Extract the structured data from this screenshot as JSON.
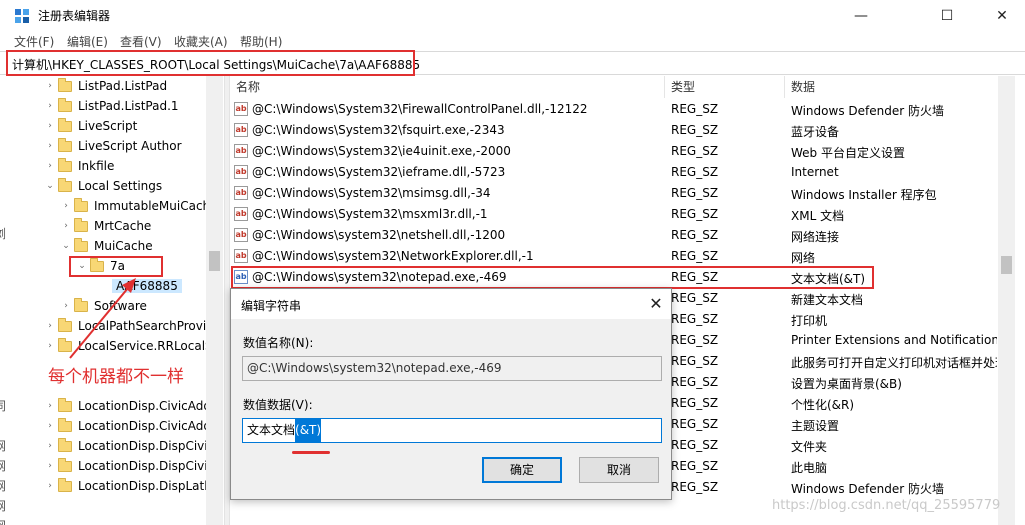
{
  "window": {
    "title": "注册表编辑器",
    "minimize_glyph": "—",
    "maximize_glyph": "☐",
    "close_glyph": "✕"
  },
  "menu": [
    "文件(F)",
    "编辑(E)",
    "查看(V)",
    "收藏夹(A)",
    "帮助(H)"
  ],
  "address": "计算机\\HKEY_CLASSES_ROOT\\Local Settings\\MuiCache\\7a\\AAF68885",
  "tree": [
    {
      "label": "ListPad.ListPad",
      "chevron": "›"
    },
    {
      "label": "ListPad.ListPad.1",
      "chevron": "›"
    },
    {
      "label": "LiveScript",
      "chevron": "›"
    },
    {
      "label": "LiveScript Author",
      "chevron": "›"
    },
    {
      "label": "Inkfile",
      "chevron": "›"
    },
    {
      "label": "Local Settings",
      "chevron": "⌄"
    },
    {
      "label": "ImmutableMuiCach",
      "chevron": "›"
    },
    {
      "label": "MrtCache",
      "chevron": "›"
    },
    {
      "label": "MuiCache",
      "chevron": "⌄"
    },
    {
      "label": "7a",
      "chevron": "⌄"
    },
    {
      "label": "AAF68885",
      "chevron": ""
    },
    {
      "label": "Software",
      "chevron": "›"
    },
    {
      "label": "LocalPathSearchProvi",
      "chevron": "›"
    },
    {
      "label": "LocalService.RRLocalS",
      "chevron": "›"
    },
    {
      "label": "LocationDisp.CivicAdd",
      "chevron": "›"
    },
    {
      "label": "LocationDisp.CivicAdd",
      "chevron": "›"
    },
    {
      "label": "LocationDisp.DispCivi",
      "chevron": "›"
    },
    {
      "label": "LocationDisp.DispCivi",
      "chevron": "›"
    },
    {
      "label": "LocationDisp.DispLatl",
      "chevron": "›"
    }
  ],
  "edge_chars": [
    "浏",
    "同",
    "网",
    "网",
    "网",
    "网",
    "网"
  ],
  "list": {
    "headers": [
      "名称",
      "类型",
      "数据"
    ],
    "rows": [
      {
        "name": "@C:\\Windows\\System32\\FirewallControlPanel.dll,-12122",
        "type": "REG_SZ",
        "data": "Windows Defender 防火墙"
      },
      {
        "name": "@C:\\Windows\\System32\\fsquirt.exe,-2343",
        "type": "REG_SZ",
        "data": "蓝牙设备"
      },
      {
        "name": "@C:\\Windows\\System32\\ie4uinit.exe,-2000",
        "type": "REG_SZ",
        "data": "Web 平台自定义设置"
      },
      {
        "name": "@C:\\Windows\\System32\\ieframe.dll,-5723",
        "type": "REG_SZ",
        "data": "Internet"
      },
      {
        "name": "@C:\\Windows\\System32\\msimsg.dll,-34",
        "type": "REG_SZ",
        "data": "Windows Installer 程序包"
      },
      {
        "name": "@C:\\Windows\\System32\\msxml3r.dll,-1",
        "type": "REG_SZ",
        "data": "XML 文档"
      },
      {
        "name": "@C:\\Windows\\system32\\netshell.dll,-1200",
        "type": "REG_SZ",
        "data": "网络连接"
      },
      {
        "name": "@C:\\Windows\\system32\\NetworkExplorer.dll,-1",
        "type": "REG_SZ",
        "data": "网络"
      },
      {
        "name": "@C:\\Windows\\system32\\notepad.exe,-469",
        "type": "REG_SZ",
        "data": "文本文档(&T)"
      },
      {
        "name": "",
        "type": "REG_SZ",
        "data": "新建文本文档"
      },
      {
        "name": "",
        "type": "REG_SZ",
        "data": "打印机"
      },
      {
        "name": "",
        "type": "REG_SZ",
        "data": "Printer Extensions and Notifications"
      },
      {
        "name": "",
        "type": "REG_SZ",
        "data": "此服务可打开自定义打印机对话框并处理"
      },
      {
        "name": "",
        "type": "REG_SZ",
        "data": "设置为桌面背景(&B)"
      },
      {
        "name": "",
        "type": "REG_SZ",
        "data": "个性化(&R)"
      },
      {
        "name": "",
        "type": "REG_SZ",
        "data": "主题设置"
      },
      {
        "name": "",
        "type": "REG_SZ",
        "data": "文件夹"
      },
      {
        "name": "",
        "type": "REG_SZ",
        "data": "此电脑"
      },
      {
        "name": "",
        "type": "REG_SZ",
        "data": "Windows Defender 防火墙"
      }
    ]
  },
  "dialog": {
    "title": "编辑字符串",
    "close_glyph": "✕",
    "name_label": "数值名称(N):",
    "name_value": "@C:\\Windows\\system32\\notepad.exe,-469",
    "data_label": "数值数据(V):",
    "data_value_plain": "文本文档",
    "data_value_selected": "(&T)",
    "ok_label": "确定",
    "cancel_label": "取消"
  },
  "annotation": {
    "text": "每个机器都不一样"
  },
  "watermark": "https://blog.csdn.net/qq_25595779",
  "colors": {
    "annotation_red": "#e03030",
    "selection_blue": "#0078d7",
    "tree_selected_bg": "#cce8ff",
    "folder_yellow": "#f8d775"
  },
  "icons": {
    "app": "registry-editor-icon",
    "folder": "folder-icon",
    "string_value": "ab-string-icon"
  }
}
